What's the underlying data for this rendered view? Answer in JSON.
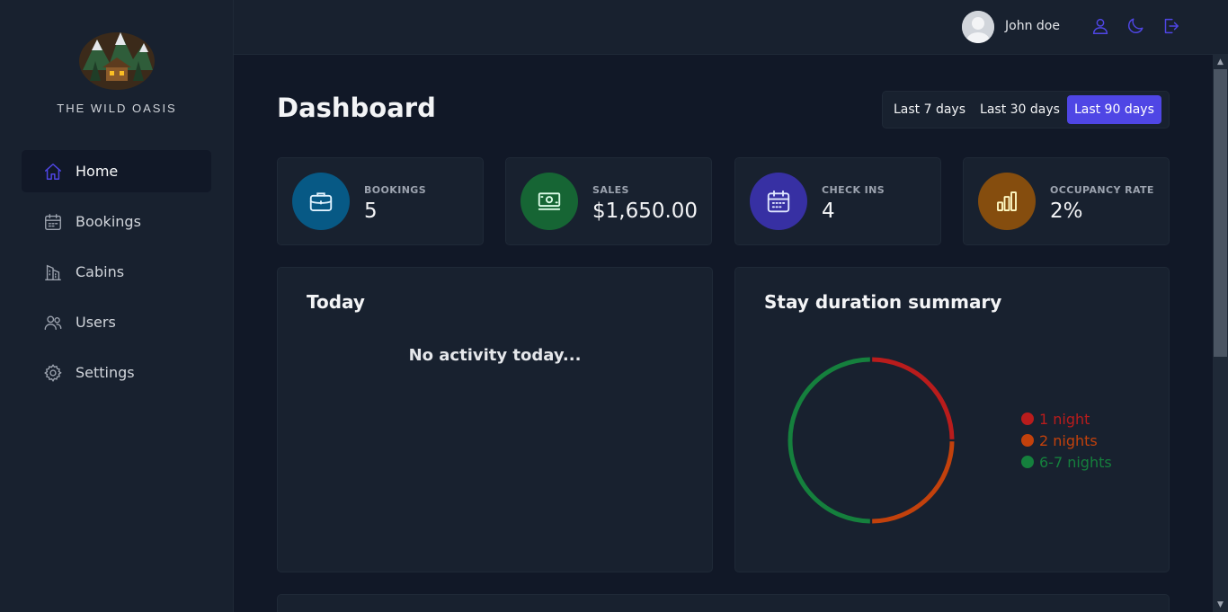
{
  "brand": {
    "name": "THE WILD OASIS"
  },
  "sidebar": {
    "items": [
      {
        "label": "Home",
        "icon": "home-icon",
        "active": true
      },
      {
        "label": "Bookings",
        "icon": "calendar-icon",
        "active": false
      },
      {
        "label": "Cabins",
        "icon": "building-icon",
        "active": false
      },
      {
        "label": "Users",
        "icon": "users-icon",
        "active": false
      },
      {
        "label": "Settings",
        "icon": "gear-icon",
        "active": false
      }
    ]
  },
  "header": {
    "username": "John doe",
    "icons": [
      "user-icon",
      "moon-icon",
      "logout-icon"
    ]
  },
  "page": {
    "title": "Dashboard",
    "filters": [
      "Last 7 days",
      "Last 30 days",
      "Last 90 days"
    ],
    "active_filter": "Last 90 days"
  },
  "stats": [
    {
      "label": "BOOKINGS",
      "value": "5",
      "icon": "briefcase-icon",
      "color": "#075985",
      "icon_color": "#e0f2fe"
    },
    {
      "label": "SALES",
      "value": "$1,650.00",
      "icon": "banknotes-icon",
      "color": "#166534",
      "icon_color": "#dcfce7"
    },
    {
      "label": "CHECK INS",
      "value": "4",
      "icon": "calendar-days-icon",
      "color": "#3730a3",
      "icon_color": "#e0e7ff"
    },
    {
      "label": "OCCUPANCY RATE",
      "value": "2%",
      "icon": "chart-bar-icon",
      "color": "#854d0e",
      "icon_color": "#fef9c3"
    }
  ],
  "today": {
    "title": "Today",
    "empty_text": "No activity today..."
  },
  "duration": {
    "title": "Stay duration summary",
    "legend": [
      {
        "label": "1 night",
        "color": "#b91c1c"
      },
      {
        "label": "2 nights",
        "color": "#c2410c"
      },
      {
        "label": "6-7 nights",
        "color": "#15803d"
      }
    ]
  },
  "chart_data": {
    "type": "pie",
    "categories": [
      "1 night",
      "2 nights",
      "6-7 nights"
    ],
    "values": [
      1,
      1,
      2
    ],
    "colors": [
      "#b91c1c",
      "#c2410c",
      "#15803d"
    ]
  }
}
